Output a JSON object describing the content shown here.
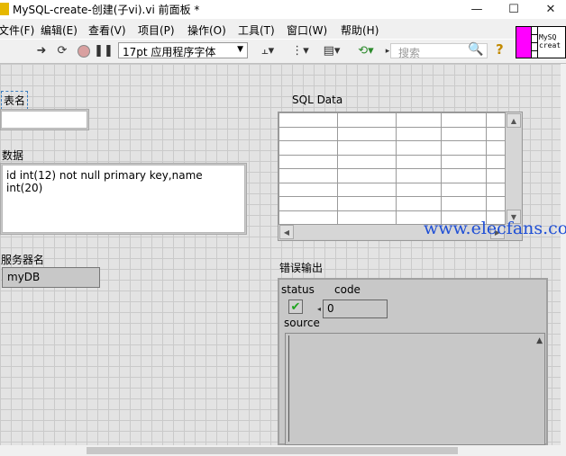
{
  "window": {
    "title": "MySQL-create-创建(子vi).vi 前面板 *",
    "controls": [
      "minimize-icon",
      "maximize-icon",
      "close-icon"
    ]
  },
  "menu": [
    "文件(F)",
    "编辑(E)",
    "查看(V)",
    "项目(P)",
    "操作(O)",
    "工具(T)",
    "窗口(W)",
    "帮助(H)"
  ],
  "toolbar": {
    "font": "17pt 应用程序字体",
    "search_placeholder": "搜索",
    "icons": [
      "run-arrow-icon",
      "run-continuous-icon",
      "abort-icon",
      "pause-icon",
      "align-icon",
      "distribute-icon",
      "resize-icon",
      "reorder-icon",
      "search-icon",
      "help-icon"
    ]
  },
  "panel": {
    "table_name_label": "表名",
    "table_name_value": "",
    "data_label": "数据",
    "data_value": "id int(12) not null primary key,name int(20)",
    "server_label": "服务器名",
    "server_value": "myDB",
    "sql_data_label": "SQL Data",
    "error_label": "错误输出",
    "error": {
      "status_label": "status",
      "code_label": "code",
      "code_value": "0",
      "source_label": "source",
      "status_ok": true
    }
  },
  "vi_icon_text": [
    "MySQ",
    "creat"
  ],
  "watermark": "www.elecfans.com",
  "colors": {
    "accent_magenta": "#ff00ff",
    "status_green": "#1fa51f"
  }
}
